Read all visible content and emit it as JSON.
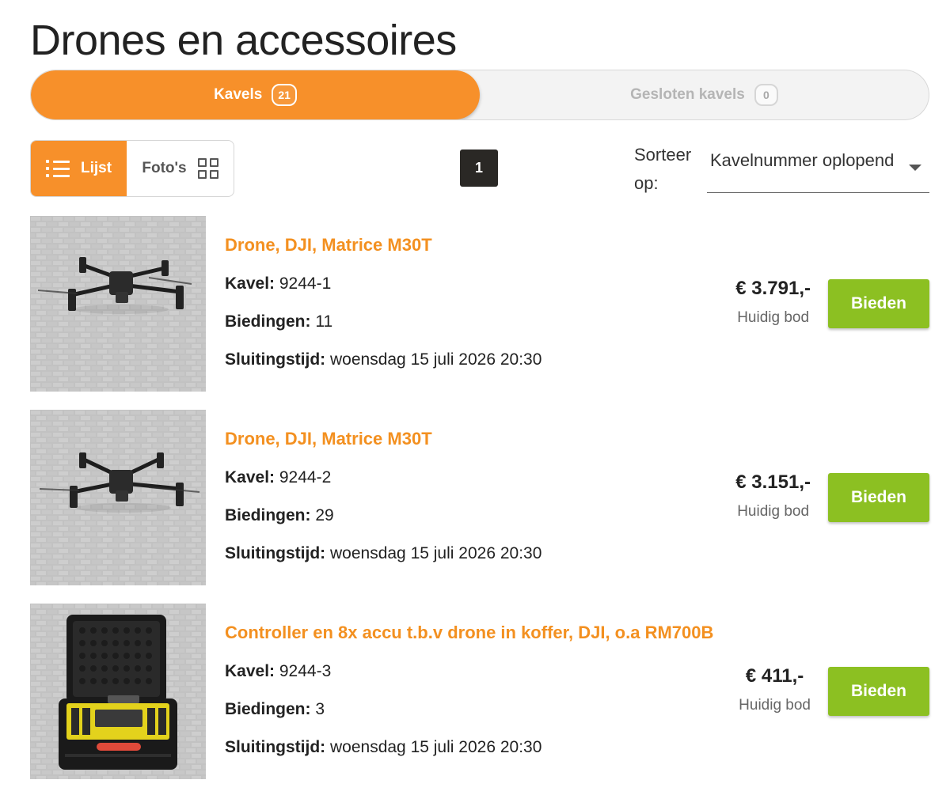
{
  "page_title": "Drones en accessoires",
  "tabs": [
    {
      "label": "Kavels",
      "count": "21",
      "active": true
    },
    {
      "label": "Gesloten kavels",
      "count": "0",
      "active": false
    }
  ],
  "view_toggle": {
    "list_label": "Lijst",
    "photos_label": "Foto's",
    "active": "list"
  },
  "pagination": {
    "current_page": "1"
  },
  "sort": {
    "label": "Sorteer op:",
    "selected": "Kavelnummer oplopend"
  },
  "field_labels": {
    "lot": "Kavel:",
    "bids": "Biedingen:",
    "closing": "Sluitingstijd:"
  },
  "lots": [
    {
      "title": "Drone, DJI, Matrice M30T",
      "lot_number": "9244-1",
      "bids": "11",
      "closing_time": "woensdag 15 juli 2026 20:30",
      "price": "€ 3.791,-",
      "price_label": "Huidig bod",
      "bid_button": "Bieden",
      "image": "drone-photo"
    },
    {
      "title": "Drone, DJI, Matrice M30T",
      "lot_number": "9244-2",
      "bids": "29",
      "closing_time": "woensdag 15 juli 2026 20:30",
      "price": "€ 3.151,-",
      "price_label": "Huidig bod",
      "bid_button": "Bieden",
      "image": "drone-photo"
    },
    {
      "title": "Controller en 8x accu t.b.v drone in koffer, DJI, o.a RM700B",
      "lot_number": "9244-3",
      "bids": "3",
      "closing_time": "woensdag 15 juli 2026 20:30",
      "price": "€ 411,-",
      "price_label": "Huidig bod",
      "bid_button": "Bieden",
      "image": "case-photo"
    }
  ],
  "colors": {
    "accent_orange": "#f7902a",
    "title_orange": "#f39020",
    "bid_green": "#8cc022",
    "pagination_dark": "#2a2825"
  }
}
